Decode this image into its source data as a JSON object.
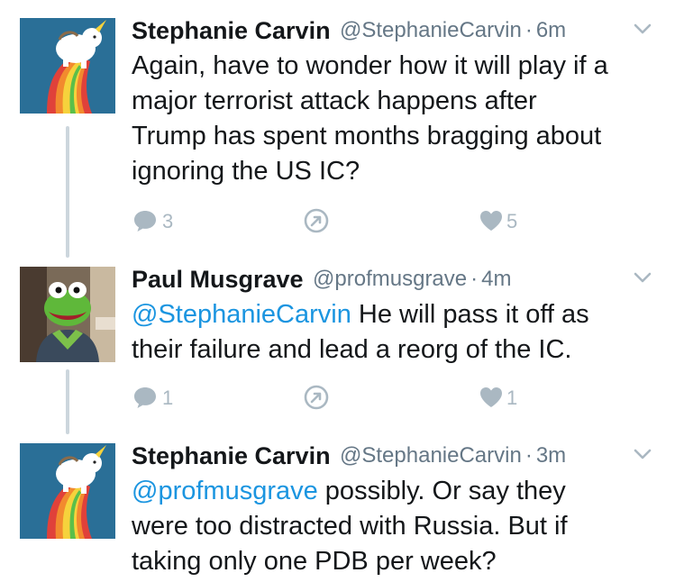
{
  "tweets": [
    {
      "name": "Stephanie Carvin",
      "handle": "@StephanieCarvin",
      "dot": "·",
      "time": "6m",
      "lines": [
        {
          "text": "Again, have to wonder how it will play if a"
        },
        {
          "text": "major terrorist attack happens after"
        },
        {
          "text": "Trump has spent months bragging about"
        },
        {
          "text": "ignoring the US IC?"
        }
      ],
      "replies": "3",
      "likes": "5",
      "avatar": "unicorn-rainbow-avatar"
    },
    {
      "name": "Paul Musgrave",
      "handle": "@profmusgrave",
      "dot": "·",
      "time": "4m",
      "mention": "@StephanieCarvin",
      "line1_rest": " He will pass it off as",
      "line2": "their failure and lead a reorg of the IC.",
      "replies": "1",
      "likes": "1",
      "avatar": "kermit-frog-avatar"
    },
    {
      "name": "Stephanie Carvin",
      "handle": "@StephanieCarvin",
      "dot": "·",
      "time": "3m",
      "mention": "@profmusgrave",
      "line1_rest": " possibly. Or say they",
      "line2": "were too distracted with Russia. But if",
      "line3": "taking only one PDB per week?",
      "avatar": "unicorn-rainbow-avatar"
    }
  ],
  "colors": {
    "accent": "#1b95e0",
    "muted": "#657786",
    "icon": "#aab8c2",
    "avatar_bg": "#2a6f97"
  },
  "icons": [
    "reply-icon",
    "retweet-icon",
    "like-icon",
    "chevron-down-icon"
  ]
}
